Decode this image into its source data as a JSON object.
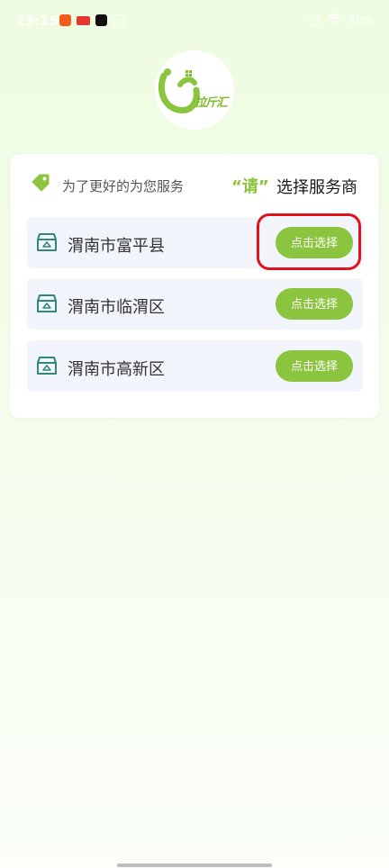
{
  "status_bar": {
    "time": "13:15",
    "battery": "40%"
  },
  "logo": {
    "text": "拉斤汇"
  },
  "header": {
    "intro": "为了更好的为您服务",
    "quote_word": "“请”",
    "action": "选择服务商"
  },
  "options": [
    {
      "label": "渭南市富平县",
      "button": "点击选择"
    },
    {
      "label": "渭南市临渭区",
      "button": "点击选择"
    },
    {
      "label": "渭南市高新区",
      "button": "点击选择"
    }
  ],
  "colors": {
    "accent": "#8bc53f",
    "annotation": "#e0121b",
    "icon_teal": "#2e8a74"
  },
  "icons": {
    "header": "tag-icon",
    "row": "store-box-icon"
  }
}
